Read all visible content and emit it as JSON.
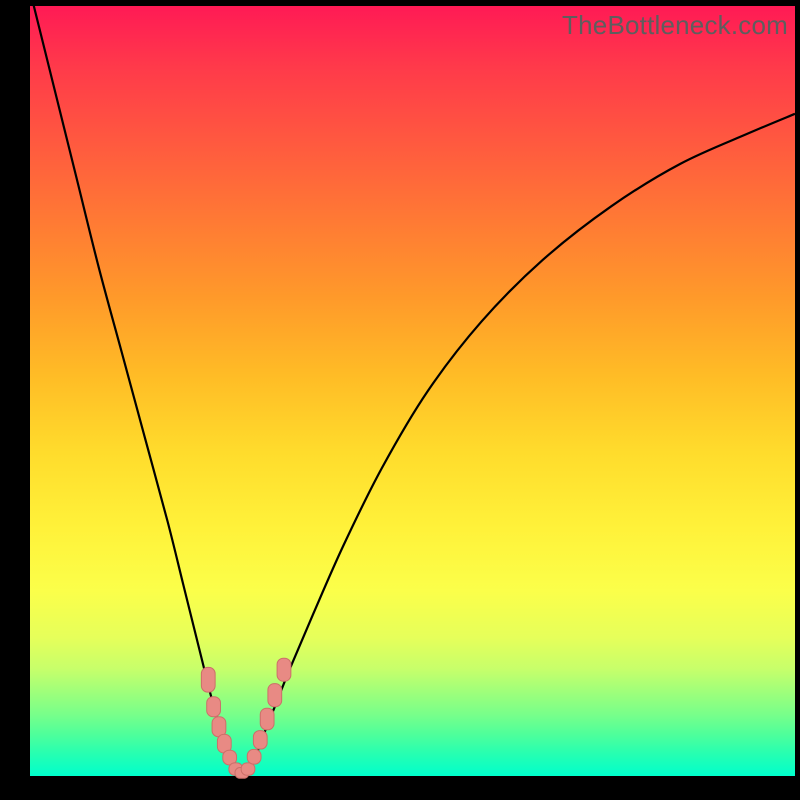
{
  "watermark": "TheBottleneck.com",
  "colors": {
    "background": "#000000",
    "curve": "#000000",
    "marker_fill": "#e88a84",
    "marker_stroke": "#cc6f69"
  },
  "chart_data": {
    "type": "line",
    "title": "",
    "xlabel": "",
    "ylabel": "",
    "xlim": [
      0,
      100
    ],
    "ylim": [
      0,
      100
    ],
    "series": [
      {
        "name": "left-branch",
        "x": [
          0,
          3,
          6,
          9,
          12,
          15,
          18,
          20,
          22,
          23.5,
          24.6,
          25.5,
          26.2,
          26.8
        ],
        "values": [
          102,
          90,
          78,
          66,
          55,
          44,
          33,
          25,
          17,
          11,
          7,
          4,
          2,
          0.8
        ]
      },
      {
        "name": "right-branch",
        "x": [
          28.5,
          29.3,
          30.4,
          32,
          34,
          37,
          41,
          46,
          52,
          59,
          67,
          76,
          85,
          94,
          100
        ],
        "values": [
          0.8,
          2,
          5,
          9,
          14,
          21,
          30,
          40,
          50,
          59,
          67,
          74,
          79.5,
          83.5,
          86
        ]
      }
    ],
    "valley_floor": {
      "x_start": 26.8,
      "x_end": 28.5,
      "y": 0.5
    },
    "markers": [
      {
        "x": 23.3,
        "y": 12.5,
        "w": 1.8,
        "h": 3.2
      },
      {
        "x": 24.0,
        "y": 9.0,
        "w": 1.8,
        "h": 2.6
      },
      {
        "x": 24.7,
        "y": 6.4,
        "w": 1.8,
        "h": 2.6
      },
      {
        "x": 25.4,
        "y": 4.2,
        "w": 1.8,
        "h": 2.4
      },
      {
        "x": 26.1,
        "y": 2.4,
        "w": 1.8,
        "h": 1.9
      },
      {
        "x": 26.9,
        "y": 0.9,
        "w": 1.8,
        "h": 1.6
      },
      {
        "x": 27.7,
        "y": 0.4,
        "w": 1.8,
        "h": 1.4
      },
      {
        "x": 28.5,
        "y": 0.9,
        "w": 1.8,
        "h": 1.6
      },
      {
        "x": 29.3,
        "y": 2.5,
        "w": 1.8,
        "h": 1.9
      },
      {
        "x": 30.1,
        "y": 4.7,
        "w": 1.8,
        "h": 2.4
      },
      {
        "x": 31.0,
        "y": 7.4,
        "w": 1.8,
        "h": 2.8
      },
      {
        "x": 32.0,
        "y": 10.5,
        "w": 1.8,
        "h": 3.0
      },
      {
        "x": 33.2,
        "y": 13.8,
        "w": 1.8,
        "h": 3.0
      }
    ]
  }
}
